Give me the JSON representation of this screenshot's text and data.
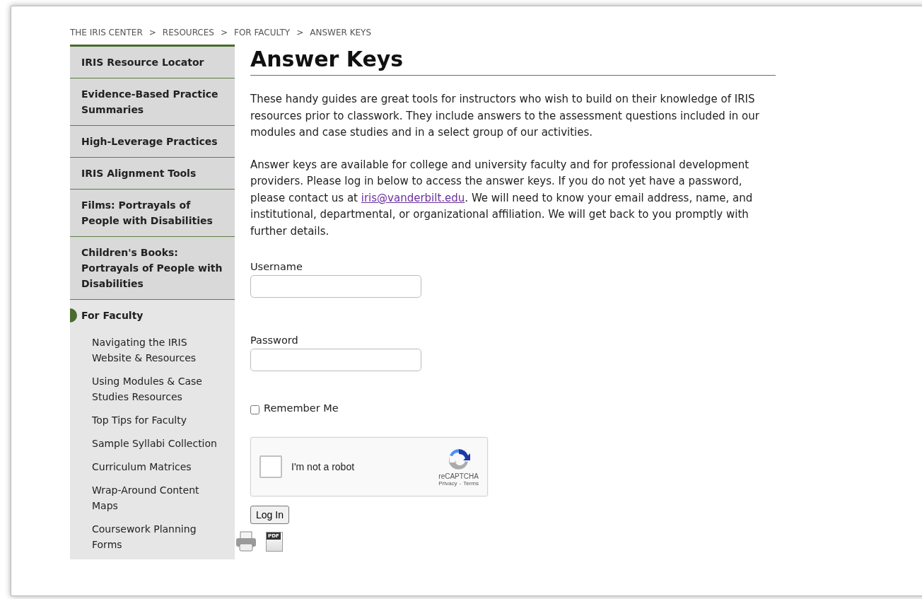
{
  "breadcrumb": {
    "items": [
      "THE IRIS CENTER",
      "RESOURCES",
      "FOR FACULTY",
      "ANSWER KEYS"
    ],
    "separator": ">"
  },
  "sidebar": {
    "items": [
      {
        "label": "IRIS Resource Locator",
        "selected": false
      },
      {
        "label": "Evidence-Based Practice Summaries",
        "selected": false
      },
      {
        "label": "High-Leverage Practices",
        "selected": false
      },
      {
        "label": "IRIS Alignment Tools",
        "selected": false
      },
      {
        "label": "Films: Portrayals of People with Disabilities",
        "selected": false
      },
      {
        "label": "Children's Books: Portrayals of People with Disabilities",
        "selected": false
      },
      {
        "label": "For Faculty",
        "selected": true,
        "children": [
          {
            "label": "Navigating the IRIS Website & Resources"
          },
          {
            "label": "Using Modules & Case Studies Resources"
          },
          {
            "label": "Top Tips for Faculty"
          },
          {
            "label": "Sample Syllabi Collection"
          },
          {
            "label": "Curriculum Matrices"
          },
          {
            "label": "Wrap-Around Content Maps"
          },
          {
            "label": "Coursework Planning Forms"
          }
        ]
      }
    ]
  },
  "page": {
    "title": "Answer Keys",
    "intro": "These handy guides are great tools for instructors who wish to build on their knowledge of IRIS resources prior to classwork. They include answers to the assessment questions included in our modules and case studies and in a select group of our activities.",
    "access": {
      "before": "Answer keys are available for college and university faculty and for professional development providers. Please log in below to access the answer keys. If you do not yet have a password, please contact us at ",
      "link": "iris@vanderbilt.edu",
      "after": ". We will need to know your email address, name, and institutional, departmental, or organizational affiliation. We will get back to you promptly with further details."
    }
  },
  "form": {
    "username": {
      "label": "Username"
    },
    "password": {
      "label": "Password"
    },
    "remember": {
      "label": "Remember Me",
      "checked": false
    },
    "captcha": {
      "label": "I'm not a robot",
      "checked": false,
      "brand": "reCAPTCHA",
      "privacy": "Privacy",
      "dash": "-",
      "terms": "Terms"
    },
    "submit": "Log In"
  },
  "tools": {
    "pdf_label": "PDF"
  }
}
